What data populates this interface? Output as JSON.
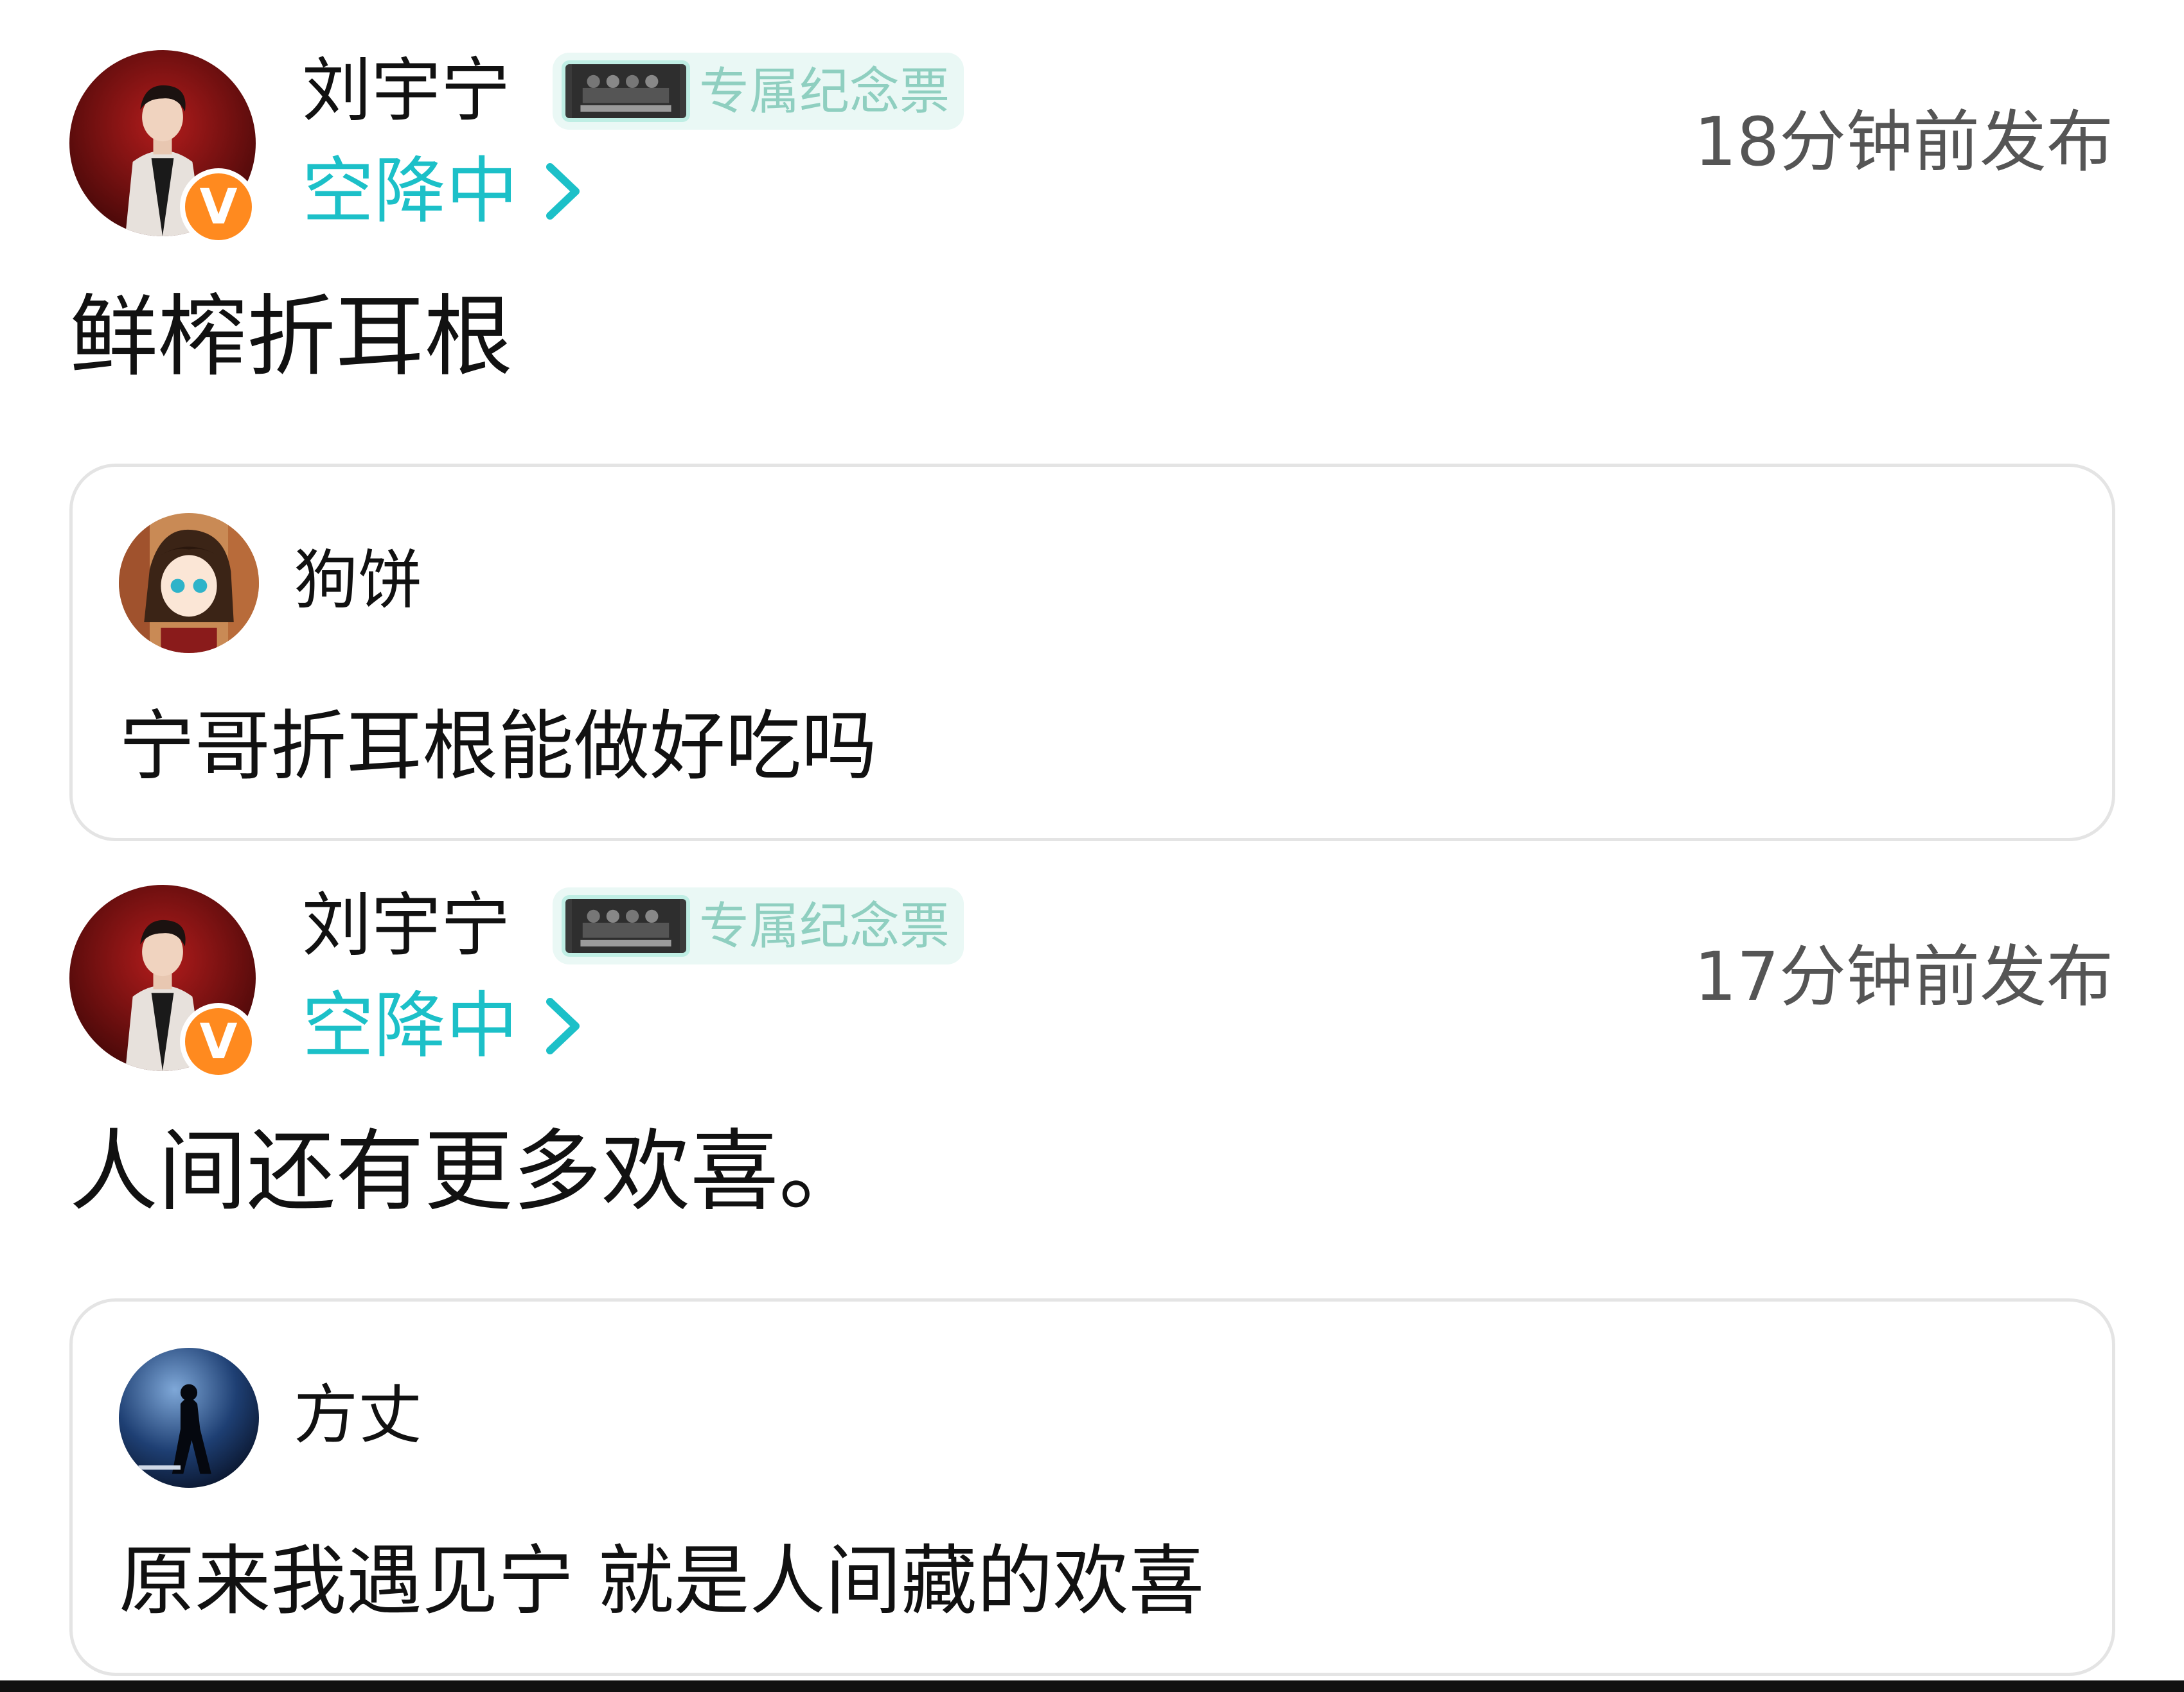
{
  "colors": {
    "accent_teal": "#1cc0c8",
    "badge_bg": "#eaf8f5",
    "badge_text": "#8fcfc0",
    "verified_orange": "#ff8a1f",
    "card_border": "#e4e4e4"
  },
  "posts": [
    {
      "author": {
        "name": "刘宇宁",
        "verified_icon": "verified-v-icon",
        "badge_label": "专属纪念票",
        "status": "空降中"
      },
      "timestamp": "18分钟前发布",
      "text": "鲜榨折耳根",
      "reply": {
        "name": "狗饼",
        "text": "宁哥折耳根能做好吃吗"
      }
    },
    {
      "author": {
        "name": "刘宇宁",
        "verified_icon": "verified-v-icon",
        "badge_label": "专属纪念票",
        "status": "空降中"
      },
      "timestamp": "17分钟前发布",
      "text": "人间还有更多欢喜。",
      "reply": {
        "name": "方丈",
        "text": "原来我遇见宁 就是人间藏的欢喜"
      }
    }
  ]
}
